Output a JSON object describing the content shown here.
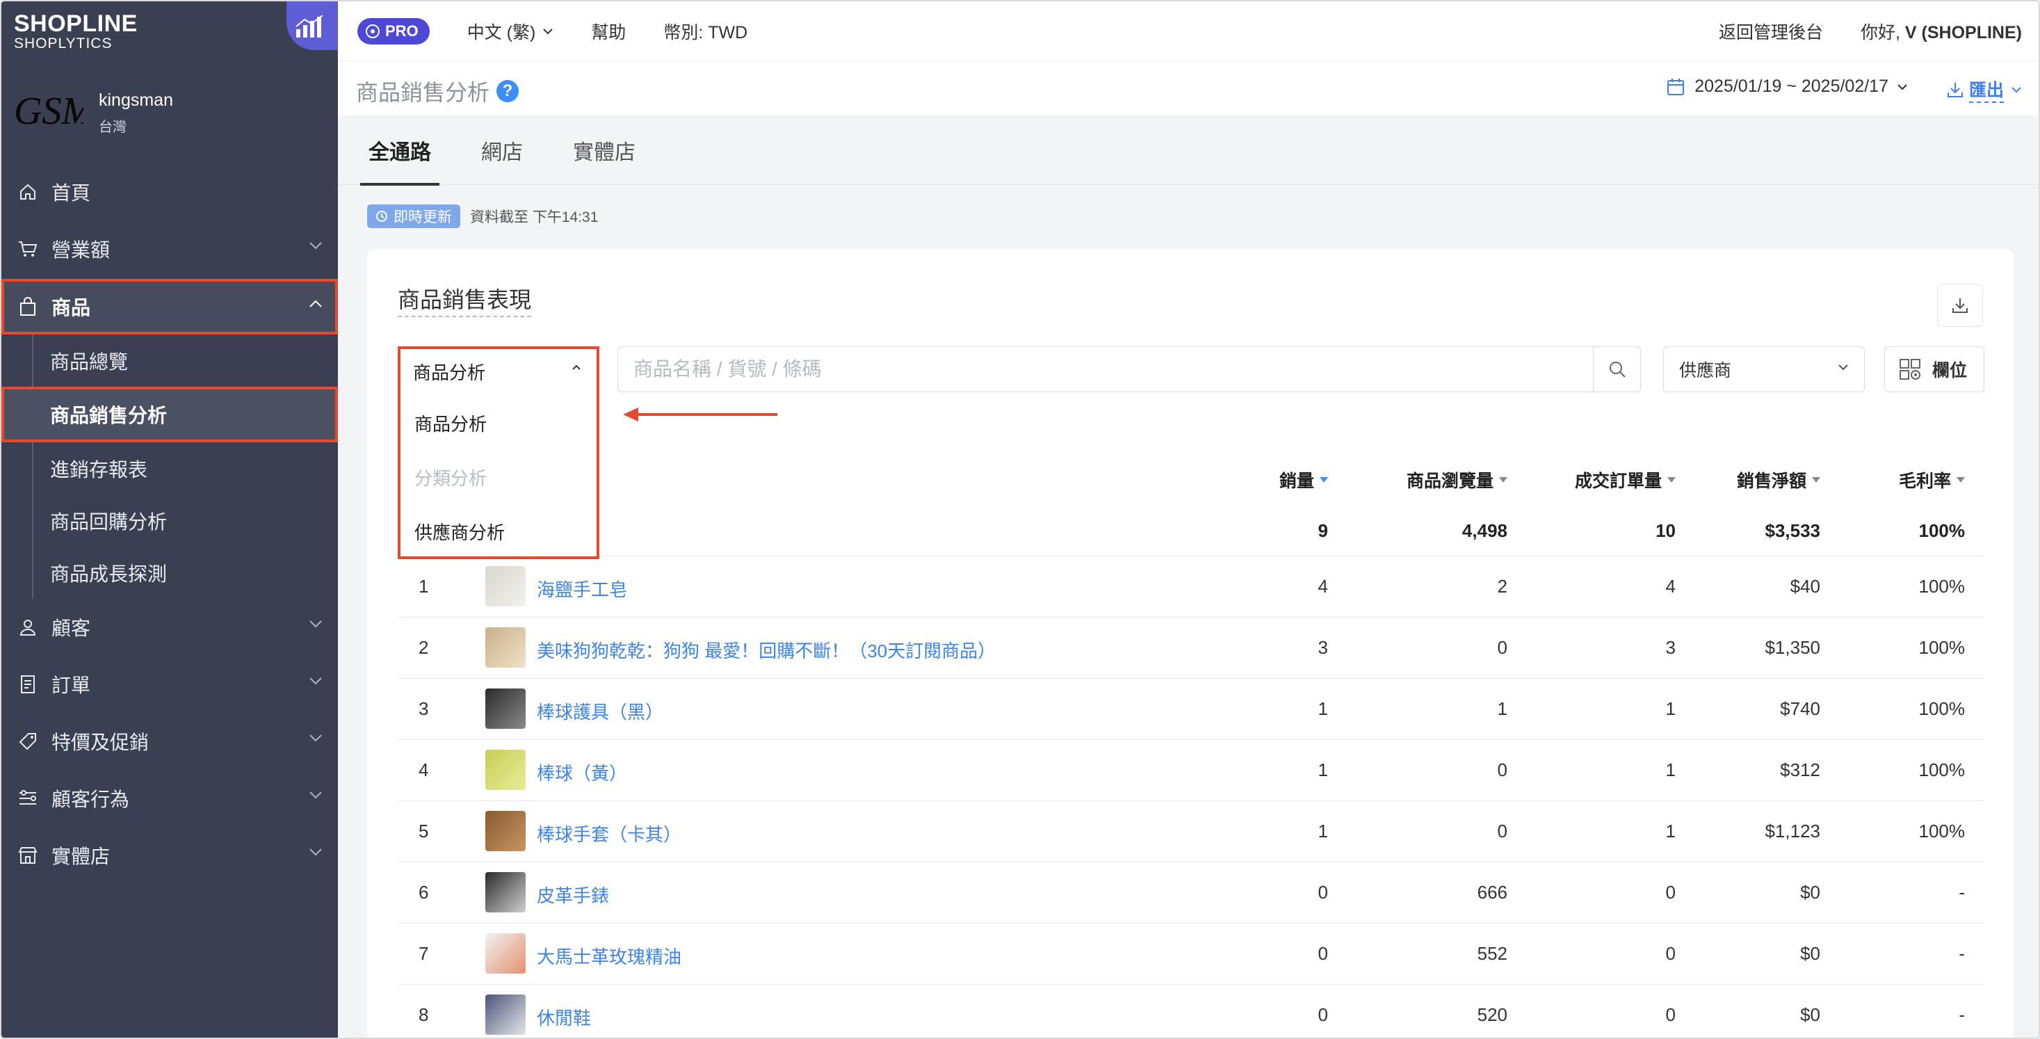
{
  "brand": {
    "line1": "SHOPLINE",
    "line2": "SHOPLYTICS"
  },
  "store": {
    "logo_text": "GSM",
    "name": "kingsman",
    "region": "台灣"
  },
  "sidebar": {
    "items": [
      {
        "label": "首頁",
        "icon": "home-icon"
      },
      {
        "label": "營業額",
        "icon": "cart-icon"
      },
      {
        "label": "商品",
        "icon": "bag-icon"
      },
      {
        "label": "顧客",
        "icon": "user-icon"
      },
      {
        "label": "訂單",
        "icon": "document-icon"
      },
      {
        "label": "特價及促銷",
        "icon": "tag-icon"
      },
      {
        "label": "顧客行為",
        "icon": "behavior-icon"
      },
      {
        "label": "實體店",
        "icon": "store-icon"
      }
    ],
    "product_sub": [
      "商品總覽",
      "商品銷售分析",
      "進銷存報表",
      "商品回購分析",
      "商品成長探測"
    ]
  },
  "topbar": {
    "pro": "PRO",
    "language": "中文 (繁)",
    "help": "幫助",
    "currency": "幣別: TWD",
    "back": "返回管理後台",
    "greeting": "你好,",
    "user": "V (SHOPLINE)"
  },
  "page": {
    "title": "商品銷售分析",
    "date_range": "2025/01/19 ~ 2025/02/17",
    "export": "匯出"
  },
  "tabs": [
    "全通路",
    "網店",
    "實體店"
  ],
  "realtime": {
    "badge": "即時更新",
    "text": "資料截至 下午14:31"
  },
  "card": {
    "title": "商品銷售表現",
    "analysis_select": {
      "current": "商品分析",
      "options": [
        "商品分析",
        "分類分析",
        "供應商分析"
      ]
    },
    "search_placeholder": "商品名稱 / 貨號 / 條碼",
    "supplier": "供應商",
    "columns_btn": "欄位"
  },
  "table": {
    "headers": [
      "銷量",
      "商品瀏覽量",
      "成交訂單量",
      "銷售淨額",
      "毛利率"
    ],
    "total": {
      "sales": "9",
      "views": "4,498",
      "orders": "10",
      "net": "$3,533",
      "margin": "100%"
    },
    "rows": [
      {
        "idx": "1",
        "name": "海鹽手工皂",
        "sales": "4",
        "views": "2",
        "orders": "4",
        "net": "$40",
        "margin": "100%"
      },
      {
        "idx": "2",
        "name": "美味狗狗乾乾：狗狗 最愛！回購不斷！（30天訂閱商品）",
        "sales": "3",
        "views": "0",
        "orders": "3",
        "net": "$1,350",
        "margin": "100%"
      },
      {
        "idx": "3",
        "name": "棒球護具（黑）",
        "sales": "1",
        "views": "1",
        "orders": "1",
        "net": "$740",
        "margin": "100%"
      },
      {
        "idx": "4",
        "name": "棒球（黃）",
        "sales": "1",
        "views": "0",
        "orders": "1",
        "net": "$312",
        "margin": "100%"
      },
      {
        "idx": "5",
        "name": "棒球手套（卡其）",
        "sales": "1",
        "views": "0",
        "orders": "1",
        "net": "$1,123",
        "margin": "100%"
      },
      {
        "idx": "6",
        "name": "皮革手錶",
        "sales": "0",
        "views": "666",
        "orders": "0",
        "net": "$0",
        "margin": "-"
      },
      {
        "idx": "7",
        "name": "大馬士革玫瑰精油",
        "sales": "0",
        "views": "552",
        "orders": "0",
        "net": "$0",
        "margin": "-"
      },
      {
        "idx": "8",
        "name": "休閒鞋",
        "sales": "0",
        "views": "520",
        "orders": "0",
        "net": "$0",
        "margin": "-"
      }
    ]
  },
  "colors": {
    "sidebar": "#3a4052",
    "accent": "#4e48d8",
    "link": "#3e85e6",
    "highlight": "#e64a2e"
  }
}
